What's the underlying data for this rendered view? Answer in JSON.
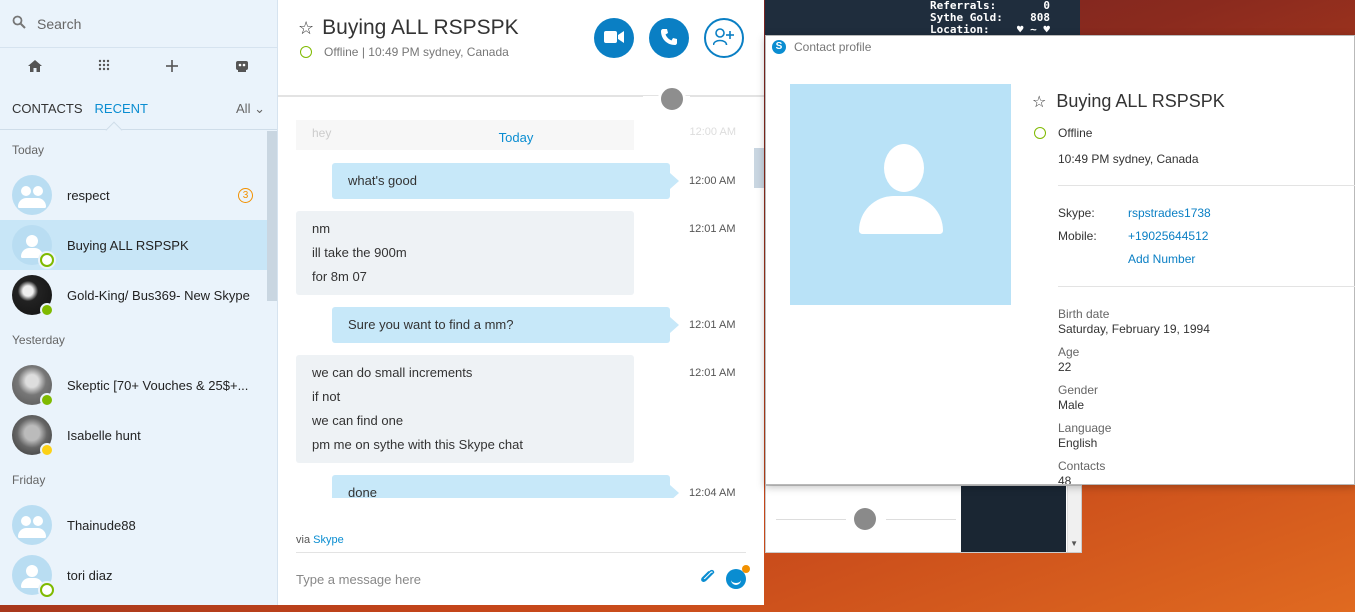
{
  "desktop": {
    "stats": [
      {
        "label": "Referrals:",
        "value": "0"
      },
      {
        "label": "Sythe Gold:",
        "value": "808"
      },
      {
        "label": "Location:",
        "value": "♥ ~ ♥"
      }
    ]
  },
  "sidebar": {
    "search_placeholder": "Search",
    "tabs": {
      "contacts": "CONTACTS",
      "recent": "RECENT",
      "filter": "All"
    },
    "sections": [
      {
        "title": "Today",
        "items": [
          {
            "name": "respect",
            "badge": "3"
          },
          {
            "name": "Buying ALL RSPSPK"
          },
          {
            "name": "Gold-King/ Bus369- New Skype"
          }
        ]
      },
      {
        "title": "Yesterday",
        "items": [
          {
            "name": "Skeptic [70+ Vouches & 25$+..."
          },
          {
            "name": "Isabelle hunt"
          }
        ]
      },
      {
        "title": "Friday",
        "items": [
          {
            "name": "Thainude88"
          },
          {
            "name": "tori diaz"
          }
        ]
      }
    ]
  },
  "chat": {
    "title": "Buying ALL RSPSPK",
    "status": "Offline",
    "separator": "|",
    "local_time": "10:49 PM sydney, Canada",
    "ghost_text": "hey",
    "ghost_time": "12:00 AM",
    "day_label": "Today",
    "messages": [
      {
        "lines": [
          "what's good"
        ],
        "time": "12:00 AM"
      },
      {
        "lines": [
          "nm",
          "ill take the 900m",
          "for 8m 07"
        ],
        "time": "12:01 AM"
      },
      {
        "lines": [
          "Sure you want to find a mm?"
        ],
        "time": "12:01 AM"
      },
      {
        "lines": [
          "we can do small increments",
          "if not",
          "we can find one",
          "pm me on sythe with this Skype chat"
        ],
        "time": "12:01 AM"
      },
      {
        "lines": [
          "done"
        ],
        "time": "12:04 AM"
      }
    ],
    "via_prefix": "via",
    "via_link": "Skype",
    "composer_placeholder": "Type a message here"
  },
  "profile": {
    "window_title": "Contact profile",
    "name": "Buying ALL RSPSPK",
    "status": "Offline",
    "local_time": "10:49 PM sydney, Canada",
    "skype_label": "Skype:",
    "skype_value": "rspstrades1738",
    "mobile_label": "Mobile:",
    "mobile_value": "+19025644512",
    "add_number": "Add Number",
    "fields": [
      {
        "label": "Birth date",
        "value": "Saturday, February 19, 1994"
      },
      {
        "label": "Age",
        "value": "22"
      },
      {
        "label": "Gender",
        "value": "Male"
      },
      {
        "label": "Language",
        "value": "English"
      },
      {
        "label": "Contacts",
        "value": "48"
      }
    ]
  },
  "colors": {
    "accent": "#0a8dd1",
    "button": "#0a7fc4",
    "online": "#7fba00",
    "away": "#fcd116",
    "badge": "#f29100",
    "outgoing_bubble": "#c7e8f9",
    "incoming_bubble": "#eef2f5",
    "selected_row": "#c8e6f7",
    "sidebar_bg": "#eaf3fb"
  }
}
